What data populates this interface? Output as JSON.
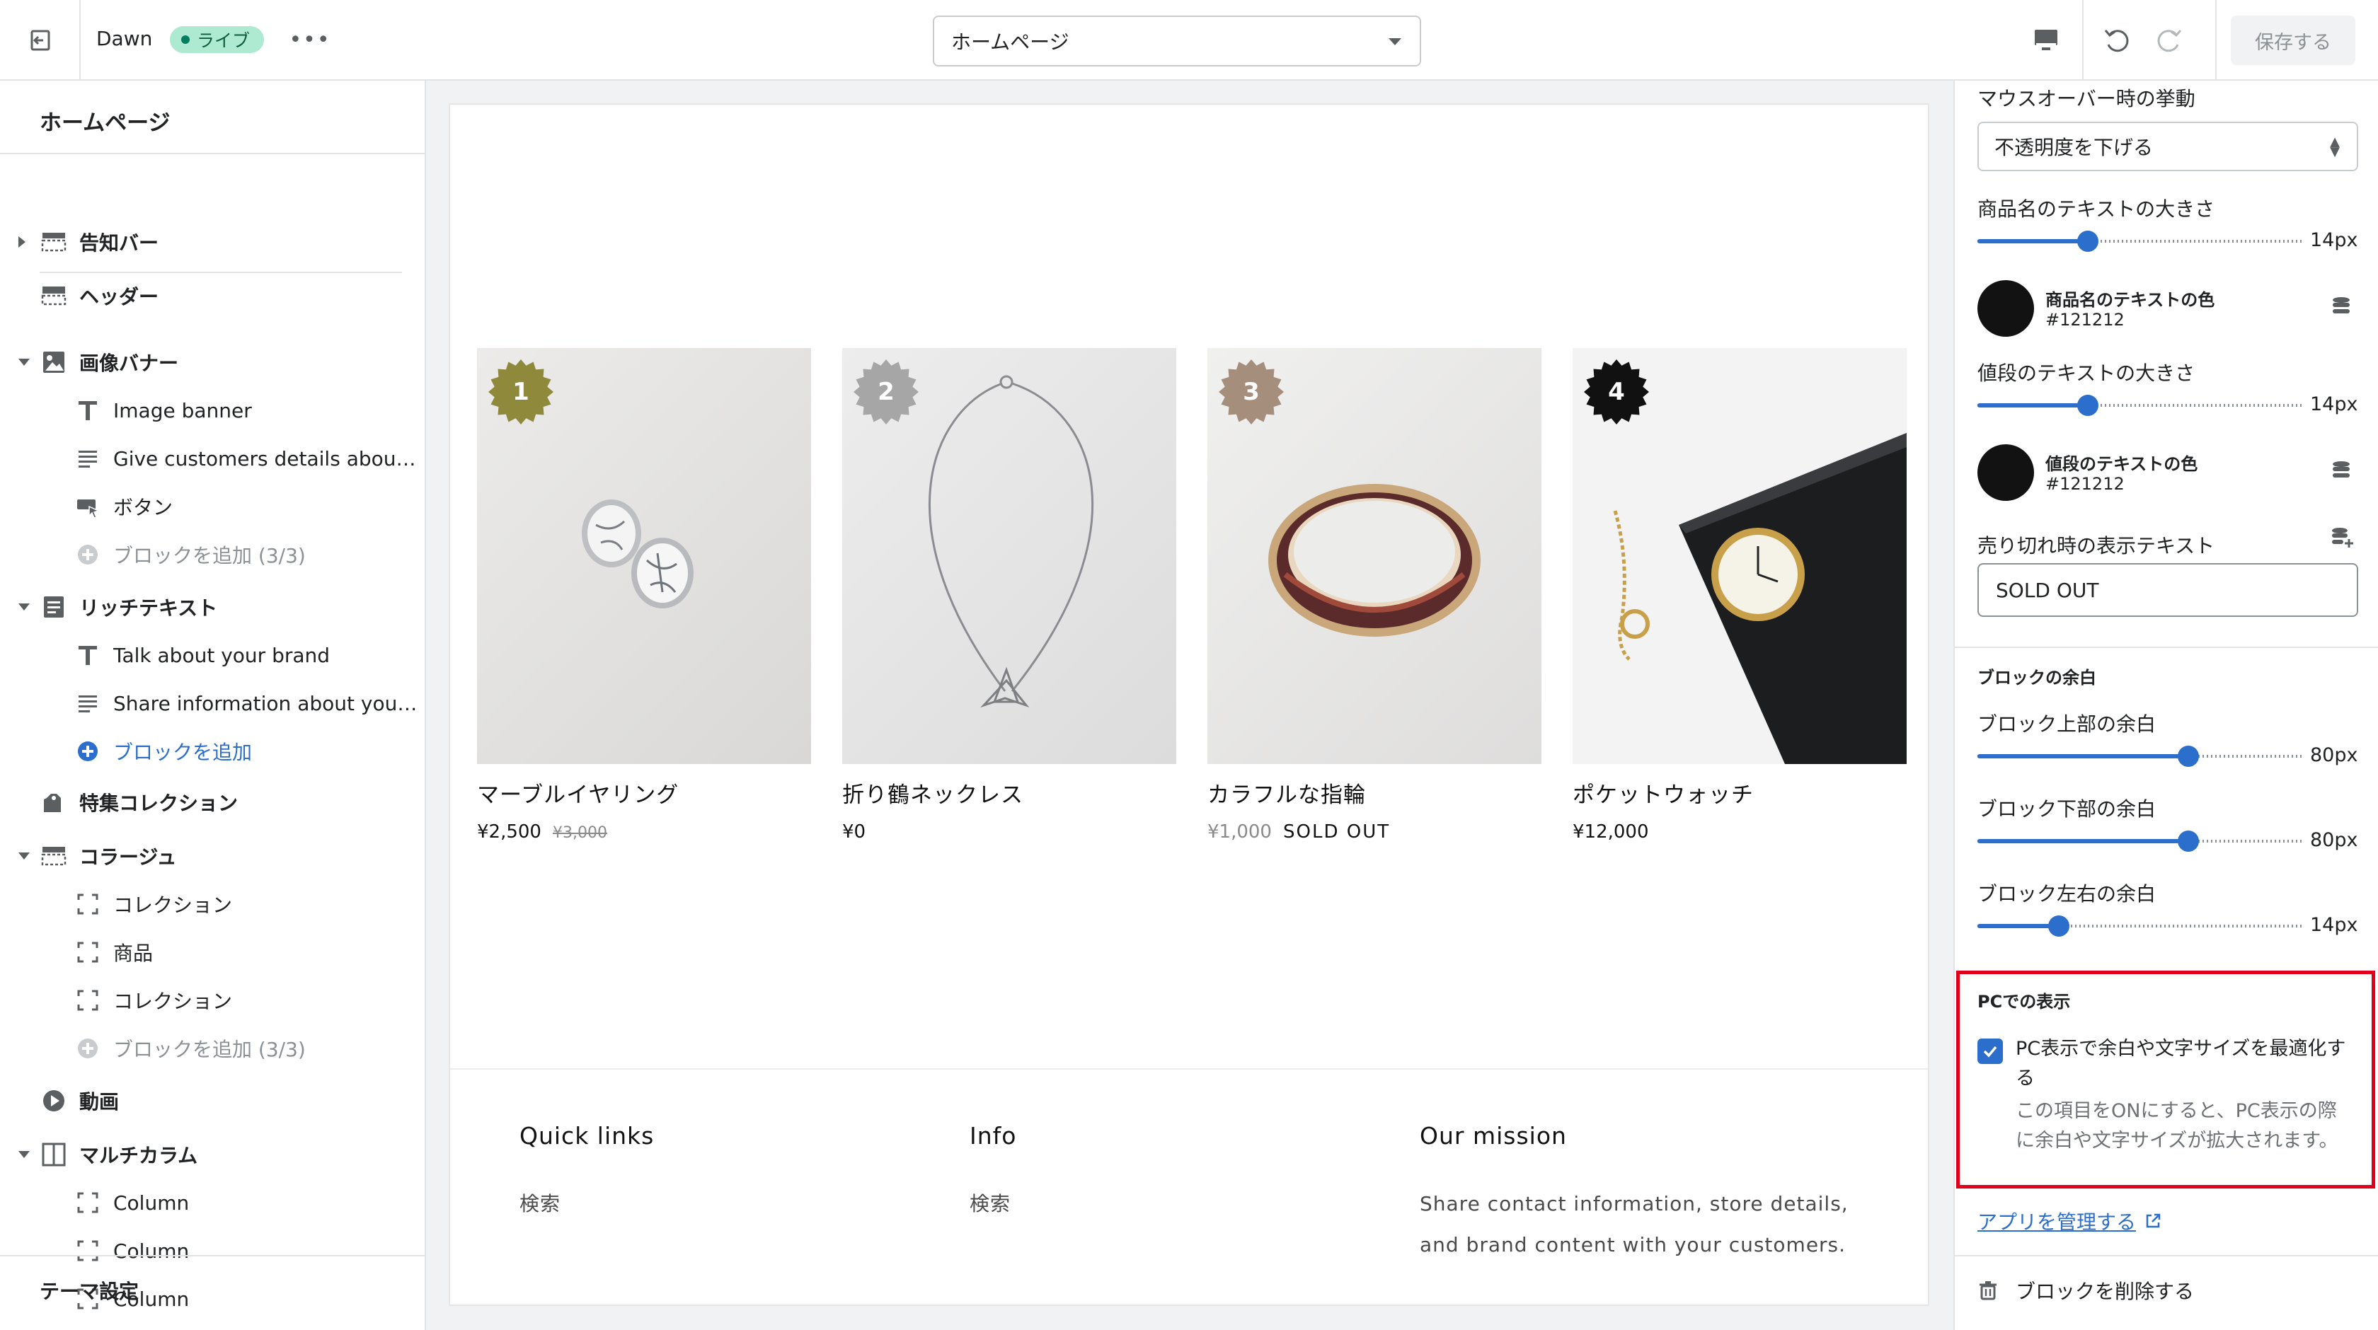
{
  "topbar": {
    "theme_name": "Dawn",
    "live_badge": "ライブ",
    "page_select": "ホームページ",
    "save_label": "保存する"
  },
  "sidebar": {
    "title": "ホームページ",
    "items": [
      {
        "label": "告知バー",
        "icon": "announcement-bar-icon",
        "arrow": "right"
      },
      {
        "label": "ヘッダー",
        "icon": "header-icon"
      },
      {
        "label": "画像バナー",
        "icon": "image-icon",
        "arrow": "down"
      },
      {
        "label": "Image banner",
        "icon": "text-icon",
        "child": true
      },
      {
        "label": "Give customers details about the banner image(s) or content on the template.",
        "icon": "text-block-icon",
        "child": true
      },
      {
        "label": "ボタン",
        "icon": "button-icon",
        "child": true
      },
      {
        "label": "ブロックを追加 (3/3)",
        "icon": "add-circle-icon",
        "child": true,
        "muted": true
      },
      {
        "label": "リッチテキスト",
        "icon": "rich-text-icon",
        "arrow": "down"
      },
      {
        "label": "Talk about your brand",
        "icon": "text-icon",
        "child": true
      },
      {
        "label": "Share information about your brand with your customers.",
        "icon": "text-block-icon",
        "child": true
      },
      {
        "label": "ブロックを追加",
        "icon": "add-circle-icon",
        "child": true,
        "link": true
      },
      {
        "label": "特集コレクション",
        "icon": "collection-icon"
      },
      {
        "label": "コラージュ",
        "icon": "collage-icon",
        "arrow": "down"
      },
      {
        "label": "コレクション",
        "icon": "frame-icon",
        "child": true
      },
      {
        "label": "商品",
        "icon": "frame-icon",
        "child": true
      },
      {
        "label": "コレクション",
        "icon": "frame-icon",
        "child": true
      },
      {
        "label": "ブロックを追加 (3/3)",
        "icon": "add-circle-icon",
        "child": true,
        "muted": true
      },
      {
        "label": "動画",
        "icon": "play-icon"
      },
      {
        "label": "マルチカラム",
        "icon": "columns-icon",
        "arrow": "down"
      },
      {
        "label": "Column",
        "icon": "frame-icon",
        "child": true
      },
      {
        "label": "Column",
        "icon": "frame-icon",
        "child": true
      },
      {
        "label": "Column",
        "icon": "frame-icon",
        "child": true
      }
    ],
    "theme_settings": "テーマ設定"
  },
  "products": [
    {
      "badge": "1",
      "badge_color": "#8f8a3b",
      "name": "マーブルイヤリング",
      "price": "¥2,500",
      "compare": "¥3,000",
      "sold_out": ""
    },
    {
      "badge": "2",
      "badge_color": "#a6a6a6",
      "name": "折り鶴ネックレス",
      "price": "¥0",
      "compare": "",
      "sold_out": ""
    },
    {
      "badge": "3",
      "badge_color": "#a58e7c",
      "name": "カラフルな指輪",
      "price": "¥1,000",
      "compare": "",
      "sold_out": "SOLD OUT"
    },
    {
      "badge": "4",
      "badge_color": "#111111",
      "name": "ポケットウォッチ",
      "price": "¥12,000",
      "compare": "",
      "sold_out": ""
    }
  ],
  "footer": {
    "quick_links": {
      "heading": "Quick links",
      "text": "検索"
    },
    "info": {
      "heading": "Info",
      "text": "検索"
    },
    "mission": {
      "heading": "Our mission",
      "text_line1": "Share contact information, store details,",
      "text_line2": "and brand content with your customers."
    }
  },
  "settings": {
    "hover_label": "マウスオーバー時の挙動",
    "hover_value": "不透明度を下げる",
    "product_name_size_label": "商品名のテキストの大きさ",
    "product_name_size_value": "14px",
    "product_name_size_fraction": 0.34,
    "product_name_color_label": "商品名のテキストの色",
    "product_name_color_hex": "#121212",
    "price_size_label": "値段のテキストの大きさ",
    "price_size_value": "14px",
    "price_size_fraction": 0.34,
    "price_color_label": "値段のテキストの色",
    "price_color_hex": "#121212",
    "sold_out_label": "売り切れ時の表示テキスト",
    "sold_out_value": "SOLD OUT",
    "block_margin_heading": "ブロックの余白",
    "margin_top_label": "ブロック上部の余白",
    "margin_top_value": "80px",
    "margin_top_fraction": 0.65,
    "margin_bottom_label": "ブロック下部の余白",
    "margin_bottom_value": "80px",
    "margin_bottom_fraction": 0.65,
    "margin_side_label": "ブロック左右の余白",
    "margin_side_value": "14px",
    "margin_side_fraction": 0.25,
    "pc_heading": "PCでの表示",
    "pc_checkbox_label": "PC表示で余白や文字サイズを最適化する",
    "pc_checkbox_checked": true,
    "pc_help": "この項目をONにすると、PC表示の際に余白や文字サイズが拡大されます。",
    "manage_app_link": "アプリを管理する",
    "delete_block": "ブロックを削除する"
  },
  "colors": {
    "accent": "#2c6ecb",
    "highlight": "#e0001b",
    "text": "#121212"
  }
}
